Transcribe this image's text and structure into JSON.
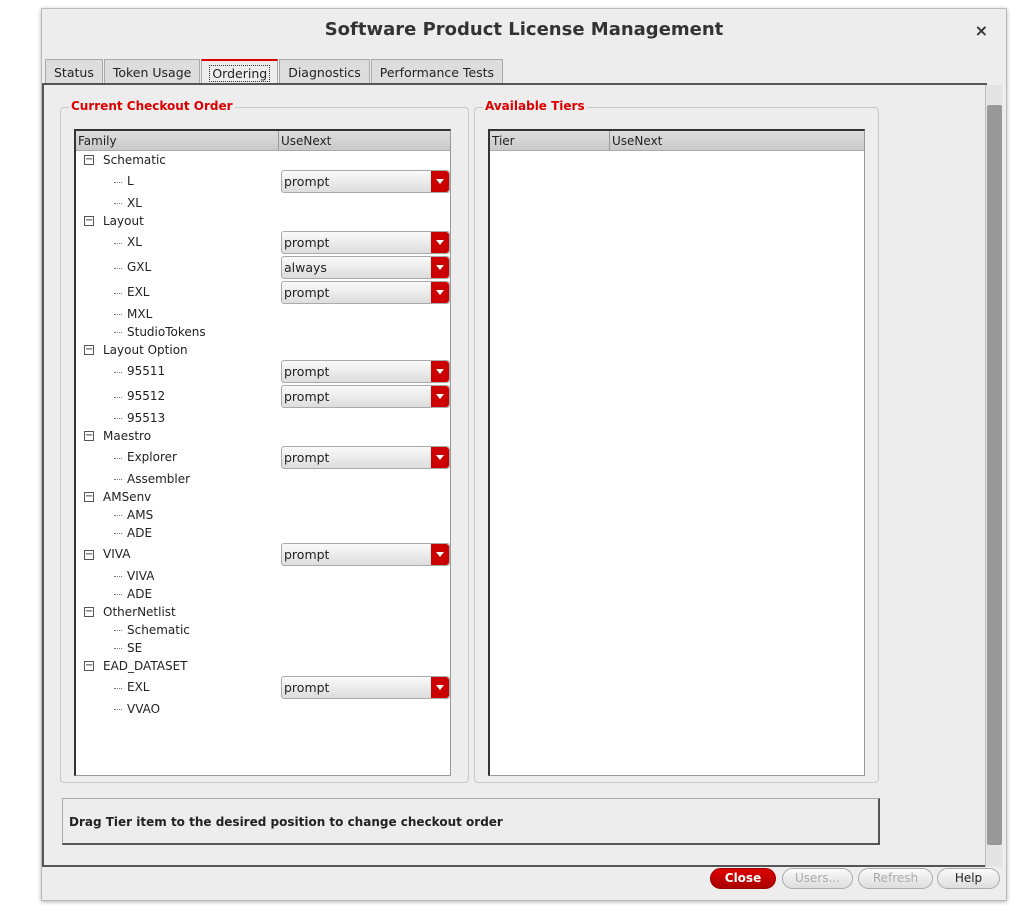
{
  "window": {
    "title": "Software Product License Management",
    "close": "×"
  },
  "tabs": [
    "Status",
    "Token Usage",
    "Ordering",
    "Diagnostics",
    "Performance Tests"
  ],
  "current": {
    "title": "Current Checkout Order",
    "col_family": "Family",
    "col_usenext": "UseNext",
    "tree": [
      {
        "label": "Schematic",
        "children": [
          {
            "label": "L",
            "usenext": "prompt"
          },
          {
            "label": "XL"
          }
        ]
      },
      {
        "label": "Layout",
        "children": [
          {
            "label": "XL",
            "usenext": "prompt"
          },
          {
            "label": "GXL",
            "usenext": "always"
          },
          {
            "label": "EXL",
            "usenext": "prompt"
          },
          {
            "label": "MXL"
          },
          {
            "label": "StudioTokens"
          }
        ]
      },
      {
        "label": "Layout Option",
        "children": [
          {
            "label": "95511",
            "usenext": "prompt"
          },
          {
            "label": "95512",
            "usenext": "prompt"
          },
          {
            "label": "95513"
          }
        ]
      },
      {
        "label": "Maestro",
        "children": [
          {
            "label": "Explorer",
            "usenext": "prompt"
          },
          {
            "label": "Assembler"
          }
        ]
      },
      {
        "label": "AMSenv",
        "children": [
          {
            "label": "AMS"
          },
          {
            "label": "ADE"
          }
        ]
      },
      {
        "label": "VIVA",
        "usenext": "prompt",
        "children": [
          {
            "label": "VIVA"
          },
          {
            "label": "ADE"
          }
        ]
      },
      {
        "label": "OtherNetlist",
        "children": [
          {
            "label": "Schematic"
          },
          {
            "label": "SE"
          }
        ]
      },
      {
        "label": "EAD_DATASET",
        "children": [
          {
            "label": "EXL",
            "usenext": "prompt"
          },
          {
            "label": "VVAO"
          }
        ]
      }
    ]
  },
  "available": {
    "title": "Available Tiers",
    "col_tier": "Tier",
    "col_usenext": "UseNext"
  },
  "message": "Drag Tier item to the desired position to change checkout order",
  "buttons": {
    "close": "Close",
    "users": "Users...",
    "refresh": "Refresh",
    "help": "Help"
  }
}
